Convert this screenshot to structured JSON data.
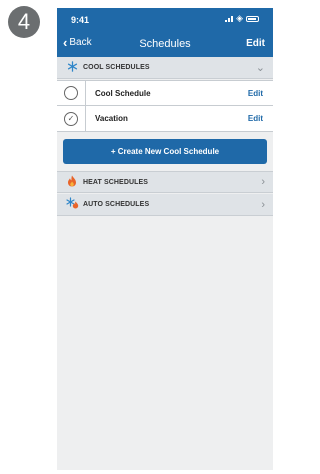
{
  "step_number": "4",
  "status_bar": {
    "time": "9:41"
  },
  "nav": {
    "back_label": "Back",
    "title": "Schedules",
    "edit_label": "Edit"
  },
  "sections": {
    "cool": {
      "label": "COOL SCHEDULES",
      "icon": "snowflake-icon",
      "expanded": true
    },
    "heat": {
      "label": "HEAT SCHEDULES",
      "icon": "flame-icon",
      "expanded": false
    },
    "auto": {
      "label": "AUTO SCHEDULES",
      "icon": "auto-icon",
      "expanded": false
    }
  },
  "cool_schedules": [
    {
      "name": "Cool Schedule",
      "edit": "Edit",
      "selected": false
    },
    {
      "name": "Vacation",
      "edit": "Edit",
      "selected": true
    }
  ],
  "create_button": "+ Create New Cool Schedule",
  "colors": {
    "accent": "#1f69a8",
    "section_bg": "#dfe3e7",
    "page_bg": "#eeeff0"
  }
}
